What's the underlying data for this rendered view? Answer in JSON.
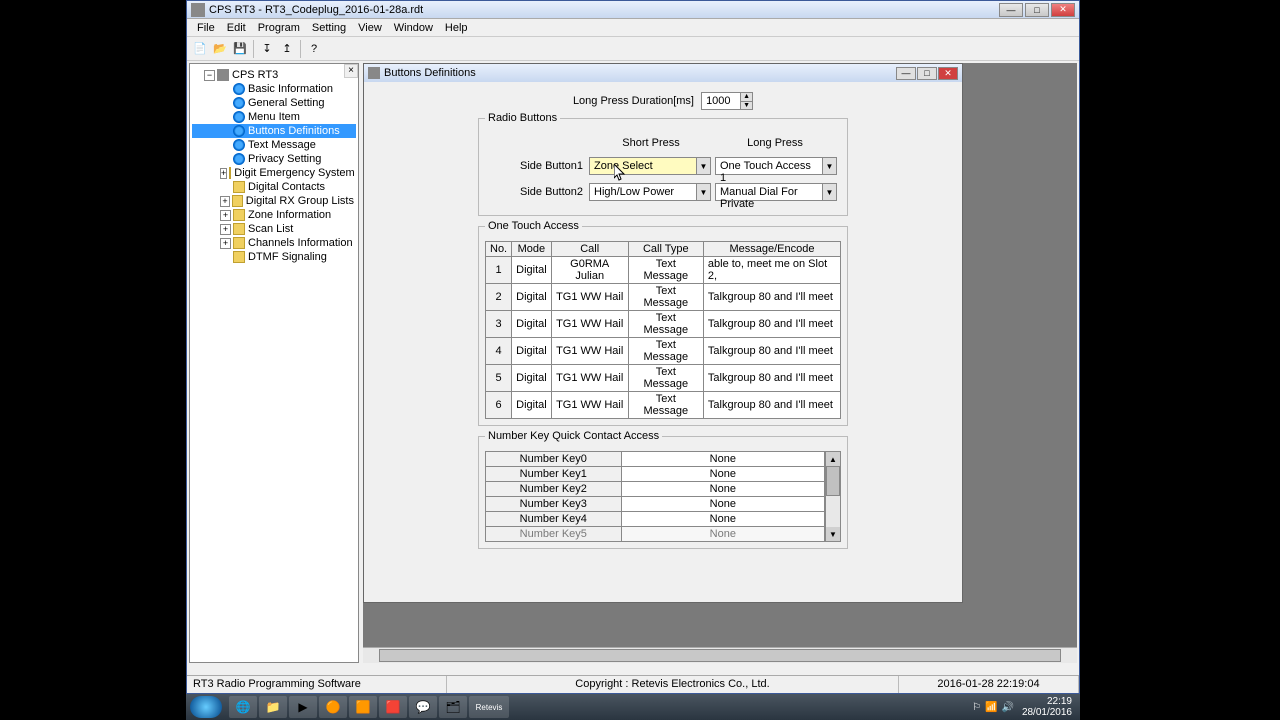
{
  "app": {
    "title": "CPS RT3 - RT3_Codeplug_2016-01-28a.rdt",
    "menus": [
      "File",
      "Edit",
      "Program",
      "Setting",
      "View",
      "Window",
      "Help"
    ]
  },
  "tree": {
    "root": "CPS RT3",
    "items": [
      {
        "label": "Basic Information",
        "icon": "radio"
      },
      {
        "label": "General Setting",
        "icon": "radio"
      },
      {
        "label": "Menu Item",
        "icon": "radio"
      },
      {
        "label": "Buttons Definitions",
        "icon": "radio",
        "selected": true
      },
      {
        "label": "Text Message",
        "icon": "radio"
      },
      {
        "label": "Privacy Setting",
        "icon": "radio"
      },
      {
        "label": "Digit Emergency System",
        "icon": "folder",
        "expandable": true
      },
      {
        "label": "Digital Contacts",
        "icon": "folder"
      },
      {
        "label": "Digital RX Group Lists",
        "icon": "folder",
        "expandable": true
      },
      {
        "label": "Zone Information",
        "icon": "folder",
        "expandable": true
      },
      {
        "label": "Scan List",
        "icon": "folder",
        "expandable": true
      },
      {
        "label": "Channels Information",
        "icon": "folder",
        "expandable": true
      },
      {
        "label": "DTMF Signaling",
        "icon": "folder"
      }
    ]
  },
  "child": {
    "title": "Buttons Definitions",
    "longPress": {
      "label": "Long Press Duration[ms]",
      "value": "1000"
    },
    "radioBox": {
      "title": "Radio Buttons",
      "shortHeader": "Short Press",
      "longHeader": "Long Press",
      "rows": [
        {
          "label": "Side Button1",
          "short": "Zone Select",
          "long": "One Touch Access 1"
        },
        {
          "label": "Side Button2",
          "short": "High/Low Power",
          "long": "Manual Dial For Private"
        }
      ]
    },
    "otaBox": {
      "title": "One Touch Access",
      "headers": [
        "No.",
        "Mode",
        "Call",
        "Call Type",
        "Message/Encode"
      ],
      "rows": [
        {
          "no": "1",
          "mode": "Digital",
          "call": "G0RMA Julian",
          "type": "Text Message",
          "msg": "able to, meet me on Slot 2,"
        },
        {
          "no": "2",
          "mode": "Digital",
          "call": "TG1 WW Hail",
          "type": "Text Message",
          "msg": "Talkgroup 80 and I'll meet"
        },
        {
          "no": "3",
          "mode": "Digital",
          "call": "TG1 WW Hail",
          "type": "Text Message",
          "msg": "Talkgroup 80 and I'll meet"
        },
        {
          "no": "4",
          "mode": "Digital",
          "call": "TG1 WW Hail",
          "type": "Text Message",
          "msg": "Talkgroup 80 and I'll meet"
        },
        {
          "no": "5",
          "mode": "Digital",
          "call": "TG1 WW Hail",
          "type": "Text Message",
          "msg": "Talkgroup 80 and I'll meet"
        },
        {
          "no": "6",
          "mode": "Digital",
          "call": "TG1 WW Hail",
          "type": "Text Message",
          "msg": "Talkgroup 80 and I'll meet"
        }
      ]
    },
    "nkBox": {
      "title": "Number Key Quick Contact Access",
      "rows": [
        {
          "key": "Number Key0",
          "val": "None"
        },
        {
          "key": "Number Key1",
          "val": "None"
        },
        {
          "key": "Number Key2",
          "val": "None"
        },
        {
          "key": "Number Key3",
          "val": "None"
        },
        {
          "key": "Number Key4",
          "val": "None"
        },
        {
          "key": "Number Key5",
          "val": "None"
        }
      ]
    }
  },
  "status": {
    "left": "RT3 Radio Programming Software",
    "center": "Copyright : Retevis Electronics Co., Ltd.",
    "right": "2016-01-28 22:19:04"
  },
  "taskbar": {
    "icons": [
      "🌐",
      "📁",
      "▶",
      "🟠",
      "🟧",
      "🟥",
      "💬",
      "🗂",
      "Retevis"
    ],
    "clock": {
      "time": "22:19",
      "date": "28/01/2016"
    }
  }
}
